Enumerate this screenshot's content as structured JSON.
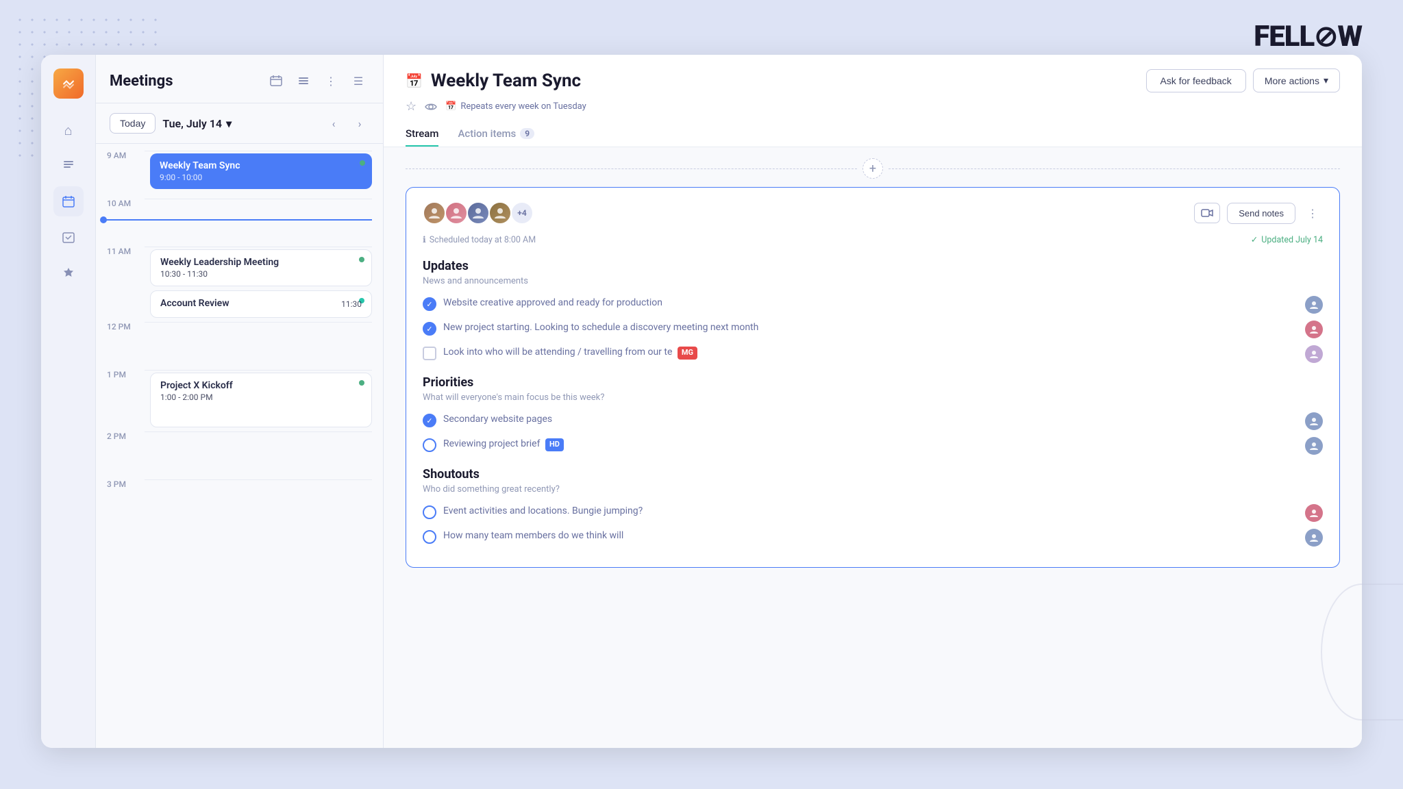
{
  "logo": {
    "text": "FELL",
    "slash": "⊘",
    "end": "W"
  },
  "sidebar": {
    "items": [
      {
        "id": "home",
        "icon": "⌂",
        "active": false
      },
      {
        "id": "chat",
        "icon": "≡",
        "active": false
      },
      {
        "id": "calendar",
        "icon": "▦",
        "active": true
      },
      {
        "id": "tasks",
        "icon": "✓",
        "active": false
      },
      {
        "id": "feedback",
        "icon": "👍",
        "active": false
      }
    ]
  },
  "meetings": {
    "title": "Meetings",
    "today_btn": "Today",
    "current_date": "Tue, July 14",
    "events": [
      {
        "title": "Weekly Team Sync",
        "time": "9:00 - 10:00",
        "type": "blue",
        "slot": "9 AM"
      },
      {
        "title": "Weekly Leadership Meeting",
        "time": "10:30 - 11:30",
        "type": "white",
        "slot": "11 AM",
        "dot": "green"
      },
      {
        "title": "Account Review",
        "time": "11:30",
        "type": "white",
        "slot": "11 AM",
        "dot": "teal"
      },
      {
        "title": "Project X Kickoff",
        "time": "1:00 - 2:00 PM",
        "type": "white",
        "slot": "1 PM",
        "dot": "green"
      }
    ],
    "time_slots": [
      "9 AM",
      "10 AM",
      "11 AM",
      "12 PM",
      "1 PM",
      "2 PM",
      "3 PM"
    ]
  },
  "meeting_detail": {
    "title": "Weekly Team Sync",
    "repeat_text": "Repeats every week on Tuesday",
    "ask_feedback_label": "Ask for feedback",
    "more_actions_label": "More actions",
    "tabs": [
      {
        "id": "stream",
        "label": "Stream",
        "active": true,
        "badge": null
      },
      {
        "id": "action-items",
        "label": "Action items",
        "active": false,
        "badge": "9"
      }
    ],
    "card": {
      "attendee_count": "+4",
      "send_notes_label": "Send notes",
      "scheduled_text": "Scheduled today at 8:00 AM",
      "updated_text": "Updated July 14"
    },
    "sections": [
      {
        "id": "updates",
        "title": "Updates",
        "subtitle": "News and announcements",
        "items": [
          {
            "text": "Website creative approved and ready for production",
            "checked": true,
            "avatar_color": "#8b9fc7",
            "tag": null
          },
          {
            "text": "New project starting. Looking to schedule a discovery meeting next month",
            "checked": true,
            "avatar_color": "#d4748a",
            "tag": null
          },
          {
            "text": "Look into who will be attending / travelling from our te",
            "checked": false,
            "square": true,
            "avatar_color": "#c0a8d4",
            "tag": "MG",
            "tag_type": "mg"
          }
        ]
      },
      {
        "id": "priorities",
        "title": "Priorities",
        "subtitle": "What will everyone's main focus be this week?",
        "items": [
          {
            "text": "Secondary website pages",
            "checked": true,
            "avatar_color": "#8b9fc7",
            "tag": null
          },
          {
            "text": "Reviewing project brief",
            "checked": false,
            "avatar_color": "#8b9fc7",
            "tag": "HD",
            "tag_type": "hd"
          }
        ]
      },
      {
        "id": "shoutouts",
        "title": "Shoutouts",
        "subtitle": "Who did something great recently?",
        "items": [
          {
            "text": "Event activities and locations. Bungie jumping?",
            "checked": false,
            "avatar_color": "#d4748a",
            "tag": null
          },
          {
            "text": "How many team members do we think will",
            "checked": false,
            "avatar_color": "#8b9fc7",
            "tag": null
          }
        ]
      }
    ]
  }
}
